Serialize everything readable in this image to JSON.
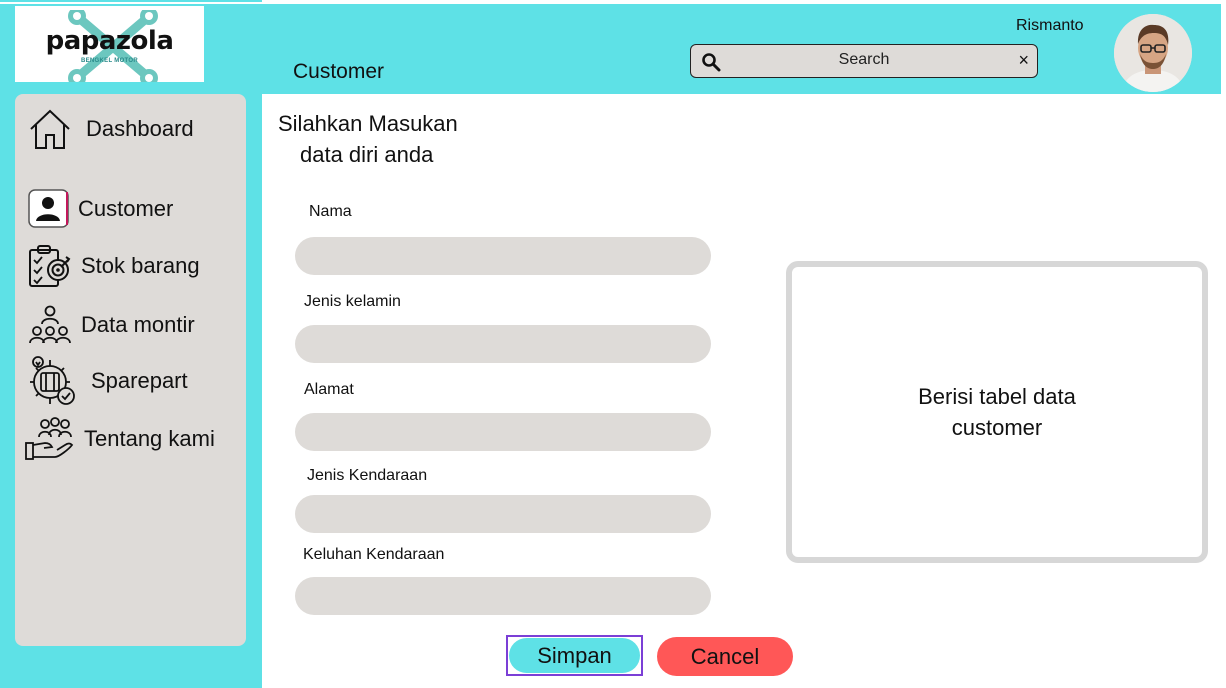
{
  "app": {
    "brand": "papazola",
    "brand_sub": "BENGKEL MOTOR",
    "page_title": "Customer"
  },
  "header": {
    "search_label": "Search",
    "clear_glyph": "×",
    "user_name": "Rismanto"
  },
  "sidebar": {
    "items": [
      {
        "label": "Dashboard",
        "icon": "home-icon"
      },
      {
        "label": "Customer",
        "icon": "user-icon",
        "active": true
      },
      {
        "label": "Stok barang",
        "icon": "checklist-icon"
      },
      {
        "label": "Data montir",
        "icon": "team-icon"
      },
      {
        "label": "Sparepart",
        "icon": "gear-icon"
      },
      {
        "label": "Tentang kami",
        "icon": "hand-people-icon"
      }
    ]
  },
  "form": {
    "intro_line1": "Silahkan Masukan",
    "intro_line2": "data diri anda",
    "fields": [
      {
        "label": "Nama",
        "value": ""
      },
      {
        "label": "Jenis kelamin",
        "value": ""
      },
      {
        "label": "Alamat",
        "value": ""
      },
      {
        "label": "Jenis Kendaraan",
        "value": ""
      },
      {
        "label": "Keluhan Kendaraan",
        "value": ""
      }
    ],
    "save_label": "Simpan",
    "cancel_label": "Cancel"
  },
  "table_card": {
    "line1": "Berisi tabel data",
    "line2": "customer"
  },
  "colors": {
    "accent": "#5ee1e6",
    "panel": "#dedbd8",
    "cancel": "#ff5757",
    "focus_outline": "#7b3fd6"
  }
}
